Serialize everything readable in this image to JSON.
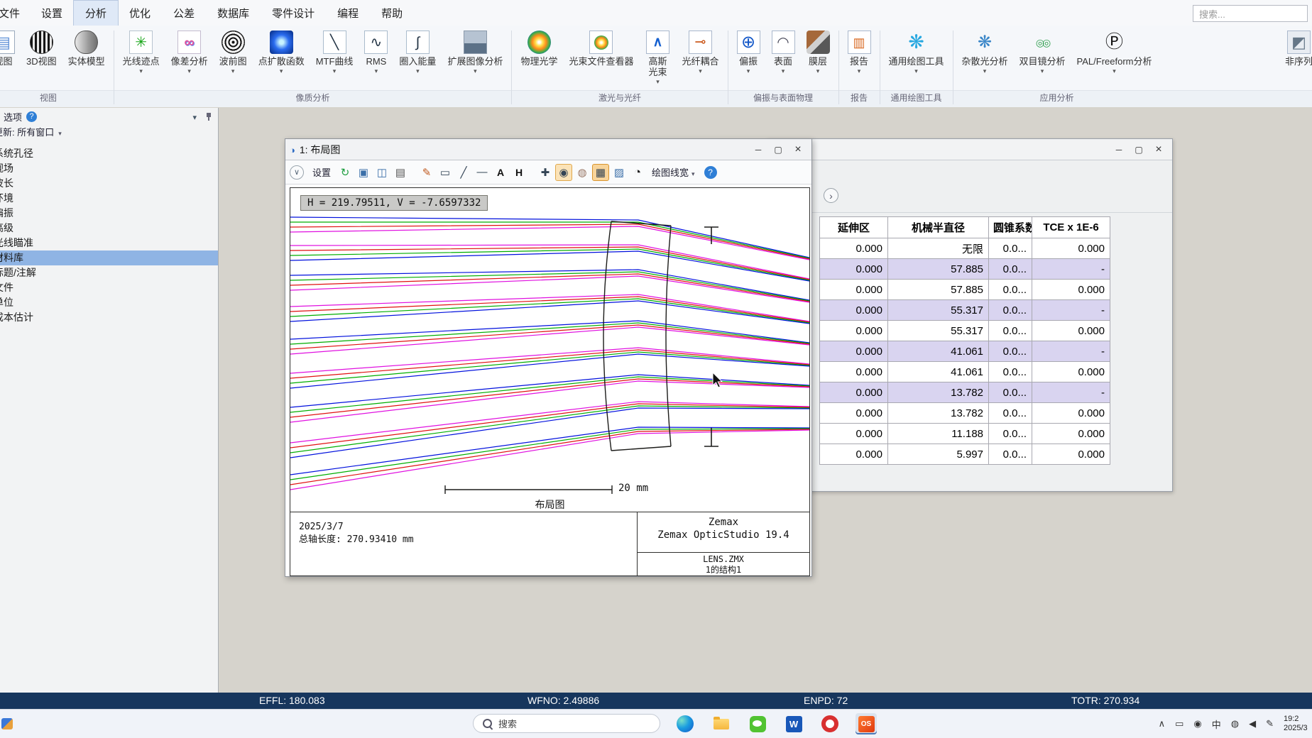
{
  "menubar": {
    "file_label": "文件",
    "tabs": [
      {
        "label": "设置"
      },
      {
        "label": "分析",
        "cls": "active"
      },
      {
        "label": "优化"
      },
      {
        "label": "公差"
      },
      {
        "label": "数据库"
      },
      {
        "label": "零件设计"
      },
      {
        "label": "编程"
      },
      {
        "label": "帮助"
      }
    ],
    "search_placeholder": "搜索..."
  },
  "ribbon": {
    "groups": [
      {
        "label": "视图",
        "items": [
          {
            "label": "视图",
            "icon": "layout-view-icon"
          },
          {
            "label": "3D视图",
            "icon": "view-3d-icon"
          },
          {
            "label": "实体模型",
            "icon": "solid-model-icon"
          }
        ]
      },
      {
        "label": "像质分析",
        "items": [
          {
            "label": "光线迹点",
            "icon": "ray-trace-icon",
            "arrow": true
          },
          {
            "label": "像差分析",
            "icon": "aberration-icon",
            "arrow": true
          },
          {
            "label": "波前图",
            "icon": "wavefront-icon",
            "arrow": true
          },
          {
            "label": "点扩散函数",
            "icon": "psf-icon",
            "arrow": true
          },
          {
            "label": "MTF曲线",
            "icon": "mtf-icon",
            "arrow": true
          },
          {
            "label": "RMS",
            "icon": "rms-icon",
            "arrow": true
          },
          {
            "label": "圈入能量",
            "icon": "encircled-energy-icon",
            "arrow": true
          },
          {
            "label": "扩展图像分析",
            "icon": "extended-image-icon",
            "arrow": true
          }
        ]
      },
      {
        "label": "激光与光纤",
        "items": [
          {
            "label": "物理光学",
            "icon": "physical-optics-icon"
          },
          {
            "label": "光束文件查看器",
            "icon": "beam-viewer-icon"
          },
          {
            "label": "高斯光束",
            "icon": "gaussian-beam-icon",
            "arrow": true,
            "narrow": true
          },
          {
            "label": "光纤耦合",
            "icon": "fiber-coupling-icon",
            "arrow": true
          }
        ]
      },
      {
        "label": "偏振与表面物理",
        "items": [
          {
            "label": "偏振",
            "icon": "polarization-icon",
            "arrow": true
          },
          {
            "label": "表面",
            "icon": "surface-icon",
            "arrow": true
          },
          {
            "label": "膜层",
            "icon": "coating-icon",
            "arrow": true
          }
        ]
      },
      {
        "label": "报告",
        "items": [
          {
            "label": "报告",
            "icon": "report-icon",
            "arrow": true
          }
        ]
      },
      {
        "label": "通用绘图工具",
        "items": [
          {
            "label": "通用绘图工具",
            "icon": "universal-plot-icon",
            "arrow": true
          }
        ]
      },
      {
        "label": "应用分析",
        "items": [
          {
            "label": "杂散光分析",
            "icon": "stray-light-icon",
            "arrow": true
          },
          {
            "label": "双目镜分析",
            "icon": "biocular-icon",
            "arrow": true
          },
          {
            "label": "PAL/Freeform分析",
            "icon": "pal-freeform-icon",
            "arrow": true
          }
        ]
      },
      {
        "label": "",
        "items": [
          {
            "label": "非序列",
            "icon": "nonsequential-icon"
          }
        ]
      }
    ]
  },
  "sidebar": {
    "title": "选项",
    "update_label": "更新: 所有窗口",
    "items": [
      {
        "label": "系统孔径"
      },
      {
        "label": "视场"
      },
      {
        "label": "波长"
      },
      {
        "label": "环境"
      },
      {
        "label": "偏振"
      },
      {
        "label": "高级"
      },
      {
        "label": "光线瞄准"
      },
      {
        "label": "材料库",
        "cls": "sel"
      },
      {
        "label": "标题/注解"
      },
      {
        "label": "文件"
      },
      {
        "label": "单位"
      },
      {
        "label": "成本估计"
      }
    ]
  },
  "layout_window": {
    "title": "1: 布局图",
    "toolbar": {
      "settings_label": "设置",
      "linewidth_label": "绘图线宽",
      "buttons": [
        {
          "glyph": "↻",
          "name": "refresh-icon"
        },
        {
          "glyph": "▣",
          "name": "copy-icon"
        },
        {
          "glyph": "◫",
          "name": "save-icon"
        },
        {
          "glyph": "▤",
          "name": "print-icon"
        },
        {
          "glyph": "✎",
          "name": "annotate-icon"
        },
        {
          "glyph": "▭",
          "name": "rectangle-tool-icon"
        },
        {
          "glyph": "╱",
          "name": "line-tool-icon"
        },
        {
          "glyph": "—",
          "name": "dash-tool-icon"
        },
        {
          "glyph": "A",
          "name": "text-tool-icon"
        },
        {
          "glyph": "H",
          "name": "h-tool-icon"
        },
        {
          "glyph": "✚",
          "name": "pan-icon"
        },
        {
          "glyph": "◉",
          "name": "zoom-icon",
          "cls": "active"
        },
        {
          "glyph": "◍",
          "name": "lamp-icon"
        },
        {
          "glyph": "▦",
          "name": "grid-icon",
          "cls": "active2"
        },
        {
          "glyph": "▨",
          "name": "image-export-icon"
        },
        {
          "glyph": "◔",
          "name": "clock-icon"
        }
      ]
    },
    "readout": "H = 219.79511, V = -7.6597332",
    "scale_label": "20 mm",
    "caption": "布局图",
    "footer": {
      "date": "2025/3/7",
      "length": "总轴长度:  270.93410 mm",
      "brand": "Zemax",
      "product": "Zemax OpticStudio 19.4",
      "file": "LENS.ZMX",
      "config": "1的结构1"
    }
  },
  "table_window": {
    "headers": [
      "延伸区",
      "机械半直径",
      "圆锥系数",
      "TCE x 1E-6"
    ],
    "rows": [
      {
        "cells": [
          "0.000",
          "无限",
          "0.0...",
          "0.000"
        ]
      },
      {
        "cells": [
          "0.000",
          "57.885",
          "0.0...",
          "-"
        ],
        "cls": "shaded"
      },
      {
        "cells": [
          "0.000",
          "57.885",
          "0.0...",
          "0.000"
        ]
      },
      {
        "cells": [
          "0.000",
          "55.317",
          "0.0...",
          "-"
        ],
        "cls": "shaded"
      },
      {
        "cells": [
          "0.000",
          "55.317",
          "0.0...",
          "0.000"
        ]
      },
      {
        "cells": [
          "0.000",
          "41.061",
          "0.0...",
          "-"
        ],
        "cls": "shaded"
      },
      {
        "cells": [
          "0.000",
          "41.061",
          "0.0...",
          "0.000"
        ]
      },
      {
        "cells": [
          "0.000",
          "13.782",
          "0.0...",
          "-"
        ],
        "cls": "shaded"
      },
      {
        "cells": [
          "0.000",
          "13.782",
          "0.0...",
          "0.000"
        ]
      },
      {
        "cells": [
          "0.000",
          "11.188",
          "0.0...",
          "0.000"
        ]
      },
      {
        "cells": [
          "0.000",
          "5.997",
          "0.0...",
          "0.000"
        ]
      }
    ]
  },
  "status": {
    "items": [
      "EFFL: 180.083",
      "WFNO: 2.49886",
      "ENPD: 72",
      "TOTR: 270.934"
    ]
  },
  "taskbar": {
    "search_label": "搜索",
    "ime": "中",
    "time": "19:2",
    "date": "2025/3"
  },
  "colors": {
    "accent": "#2b579a",
    "status_bg": "#17365d",
    "selection": "#8fb4e4",
    "shaded_row": "#d9d4f0",
    "ray_blue": "#0010dd",
    "ray_green": "#00ad00",
    "ray_red": "#e01010",
    "ray_magenta": "#e010e0"
  }
}
